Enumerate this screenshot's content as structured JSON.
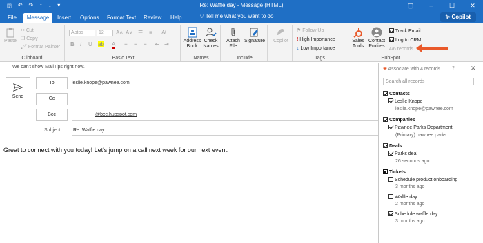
{
  "title_bar": {
    "title": "Re: Waffle day  -  Message (HTML)"
  },
  "tabs": [
    {
      "label": "File"
    },
    {
      "label": "Message"
    },
    {
      "label": "Insert"
    },
    {
      "label": "Options"
    },
    {
      "label": "Format Text"
    },
    {
      "label": "Review"
    },
    {
      "label": "Help"
    }
  ],
  "tell_me": "Tell me what you want to do",
  "copilot_label": "Copilot",
  "ribbon": {
    "clipboard": {
      "paste": "Paste",
      "cut": "Cut",
      "copy": "Copy",
      "format_painter": "Format Painter",
      "group": "Clipboard"
    },
    "basic_text": {
      "font": "Aptos",
      "size": "12",
      "group": "Basic Text"
    },
    "names": {
      "address_book": "Address Book",
      "check_names": "Check Names",
      "group": "Names"
    },
    "include": {
      "attach_file": "Attach File",
      "signature": "Signature",
      "group": "Include"
    },
    "copilot": {
      "label": "Copilot"
    },
    "tags": {
      "follow_up": "Follow Up",
      "high": "High Importance",
      "low": "Low Importance",
      "group": "Tags"
    },
    "hubspot": {
      "sales_tools": "Sales Tools",
      "contact_profiles": "Contact Profiles",
      "track_email": "Track Email",
      "log_to_crm": "Log to CRM",
      "records": "4/6 records",
      "group": "HubSpot"
    }
  },
  "mailtips": "We can't show MailTips right now.",
  "send_label": "Send",
  "fields": {
    "to_label": "To",
    "to_value": "leslie.knope@pawnee.com",
    "cc_label": "Cc",
    "bcc_label": "Bcc",
    "bcc_value": "@bcc.hubspot.com",
    "subject_label": "Subject",
    "subject_value": "Re: Waffle day"
  },
  "body_text": "Great to connect with you today! Let's jump on a call next week for our next event.",
  "pane": {
    "title": "Associate with 4 records",
    "search_placeholder": "Search all records",
    "contacts": {
      "heading": "Contacts",
      "name": "Leslie Knope",
      "email": "leslie.knope@pawnee.com"
    },
    "companies": {
      "heading": "Companies",
      "name": "Pawnee Parks Department",
      "detail": "(Primary) pawnee.parks"
    },
    "deals": {
      "heading": "Deals",
      "name": "Parks deal",
      "time": "26 seconds ago"
    },
    "tickets": {
      "heading": "Tickets",
      "items": [
        {
          "name": "Schedule product onboarding",
          "time": "3 months ago",
          "checked": false
        },
        {
          "name": "Waffle day",
          "time": "2 months ago",
          "checked": false
        },
        {
          "name": "Schedule waffle day",
          "time": "3 months ago",
          "checked": true
        }
      ]
    }
  },
  "colors": {
    "accent": "#1f6fc5",
    "arrow": "#e9592a"
  }
}
